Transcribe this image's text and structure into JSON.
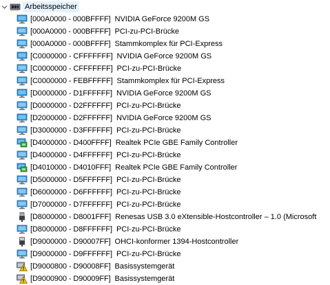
{
  "header": {
    "label": "Arbeitsspeicher",
    "icon": "memory-chip-icon"
  },
  "colors": {
    "selection": "#e5f3ff",
    "monitor_blue": "#2b8fd6",
    "network_green": "#3aa63a",
    "warning_yellow": "#f3c31a"
  },
  "items": [
    {
      "range": "[000A0000 - 000BFFFF]",
      "device": "NVIDIA GeForce 9200M GS",
      "icon": "display-adapter-icon"
    },
    {
      "range": "[000A0000 - 000BFFFF]",
      "device": "PCI-zu-PCI-Brücke",
      "icon": "system-device-icon"
    },
    {
      "range": "[000A0000 - 000BFFFF]",
      "device": "Stammkomplex für PCI-Express",
      "icon": "system-device-icon"
    },
    {
      "range": "[C0000000 - CFFFFFFF]",
      "device": "NVIDIA GeForce 9200M GS",
      "icon": "display-adapter-icon"
    },
    {
      "range": "[C0000000 - CFFFFFFF]",
      "device": "PCI-zu-PCI-Brücke",
      "icon": "system-device-icon"
    },
    {
      "range": "[C0000000 - FEBFFFFF]",
      "device": "Stammkomplex für PCI-Express",
      "icon": "system-device-icon"
    },
    {
      "range": "[D0000000 - D1FFFFFF]",
      "device": "NVIDIA GeForce 9200M GS",
      "icon": "display-adapter-icon"
    },
    {
      "range": "[D0000000 - D2FFFFFF]",
      "device": "PCI-zu-PCI-Brücke",
      "icon": "system-device-icon"
    },
    {
      "range": "[D2000000 - D2FFFFFF]",
      "device": "NVIDIA GeForce 9200M GS",
      "icon": "display-adapter-icon"
    },
    {
      "range": "[D3000000 - D3FFFFFF]",
      "device": "PCI-zu-PCI-Brücke",
      "icon": "system-device-icon"
    },
    {
      "range": "[D4000000 - D400FFFF]",
      "device": "Realtek PCIe GBE Family Controller",
      "icon": "network-adapter-icon"
    },
    {
      "range": "[D4000000 - D4FFFFFF]",
      "device": "PCI-zu-PCI-Brücke",
      "icon": "system-device-icon"
    },
    {
      "range": "[D4010000 - D4010FFF]",
      "device": "Realtek PCIe GBE Family Controller",
      "icon": "network-adapter-icon"
    },
    {
      "range": "[D5000000 - D5FFFFFF]",
      "device": "PCI-zu-PCI-Brücke",
      "icon": "system-device-icon"
    },
    {
      "range": "[D6000000 - D6FFFFFF]",
      "device": "PCI-zu-PCI-Brücke",
      "icon": "system-device-icon"
    },
    {
      "range": "[D7000000 - D7FFFFFF]",
      "device": "PCI-zu-PCI-Brücke",
      "icon": "system-device-icon"
    },
    {
      "range": "[D8000000 - D8001FFF]",
      "device": "Renesas USB 3.0 eXtensible-Hostcontroller – 1.0 (Microsoft",
      "icon": "usb-controller-icon"
    },
    {
      "range": "[D8000000 - D8FFFFFF]",
      "device": "PCI-zu-PCI-Brücke",
      "icon": "system-device-icon"
    },
    {
      "range": "[D9000000 - D90007FF]",
      "device": "OHCI-konformer 1394-Hostcontroller",
      "icon": "firewire-controller-icon"
    },
    {
      "range": "[D9000000 - D9FFFFFF]",
      "device": "PCI-zu-PCI-Brücke",
      "icon": "system-device-icon"
    },
    {
      "range": "[D9000800 - D90008FF]",
      "device": "Basissystemgerät",
      "icon": "warning-device-icon"
    },
    {
      "range": "[D9000900 - D90009FF]",
      "device": "Basissystemgerät",
      "icon": "warning-device-icon"
    }
  ]
}
